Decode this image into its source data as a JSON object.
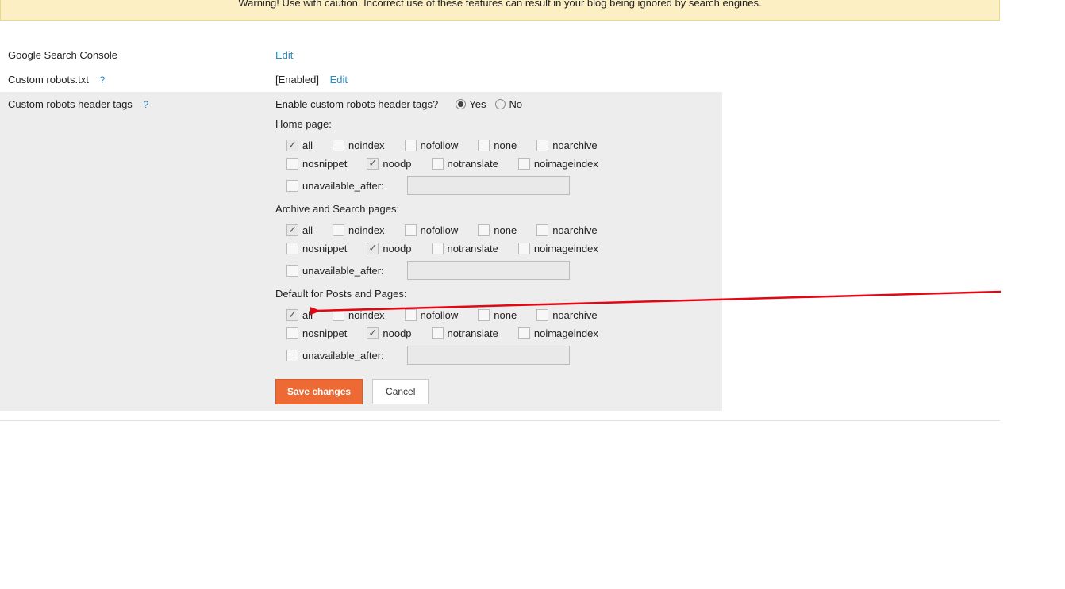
{
  "warning": "Warning! Use with caution. Incorrect use of these features can result in your blog being ignored by search engines.",
  "rows": {
    "gsc": {
      "label": "Google Search Console",
      "edit": "Edit"
    },
    "robots_txt": {
      "label": "Custom robots.txt",
      "status": "[Enabled]",
      "edit": "Edit"
    },
    "robots_header": {
      "label": "Custom robots header tags",
      "enable_question": "Enable custom robots header tags?",
      "yes": "Yes",
      "no": "No",
      "sections": {
        "home": "Home page:",
        "archive": "Archive and Search pages:",
        "posts": "Default for Posts and Pages:"
      },
      "options": {
        "all": "all",
        "noindex": "noindex",
        "nofollow": "nofollow",
        "none": "none",
        "noarchive": "noarchive",
        "nosnippet": "nosnippet",
        "noodp": "noodp",
        "notranslate": "notranslate",
        "noimageindex": "noimageindex",
        "unavailable_after": "unavailable_after:"
      },
      "buttons": {
        "save": "Save changes",
        "cancel": "Cancel"
      }
    }
  },
  "help_icon": "?"
}
